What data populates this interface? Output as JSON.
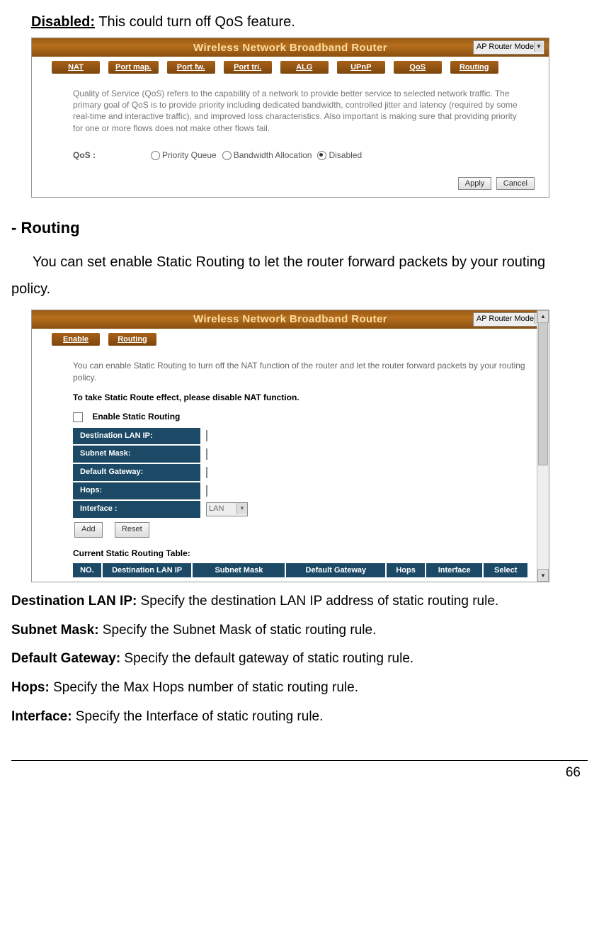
{
  "disabled": {
    "label": "Disabled:",
    "text": "  This could turn off QoS feature."
  },
  "ss1": {
    "banner": "Wireless Network Broadband Router",
    "mode": "AP Router Mode",
    "tabs": [
      "NAT",
      "Port map.",
      "Port fw.",
      "Port tri.",
      "ALG",
      "UPnP",
      "QoS",
      "Routing"
    ],
    "desc": "Quality of Service (QoS) refers to the capability of a network to provide better service to selected network traffic. The primary goal of QoS is to provide priority including dedicated bandwidth, controlled jitter and latency (required by some real-time and interactive traffic), and improved loss characteristics. Also important is making sure that providing priority for one or more flows does not make other flows fail.",
    "qos_label": "QoS :",
    "opts": [
      "Priority Queue",
      "Bandwidth Allocation",
      "Disabled"
    ],
    "apply": "Apply",
    "cancel": "Cancel"
  },
  "routing_heading": "- Routing",
  "routing_para": "You can set enable Static Routing to let the router forward packets by your routing policy.",
  "ss2": {
    "banner": "Wireless Network Broadband Router",
    "mode": "AP Router Mode",
    "tabs": [
      "Enable",
      "Routing"
    ],
    "desc": "You can enable Static Routing to turn off the NAT function of the router and let the router forward packets by your routing policy.",
    "note": "To take Static Route effect, please disable NAT function.",
    "enable_label": "Enable Static Routing",
    "rows": {
      "dlan": "Destination LAN IP:",
      "sm": "Subnet Mask:",
      "dg": "Default Gateway:",
      "hops": "Hops:",
      "iface": "Interface :",
      "iface_val": "LAN"
    },
    "add": "Add",
    "reset": "Reset",
    "cur": "Current Static Routing Table:",
    "th": {
      "no": "NO.",
      "dlan": "Destination LAN IP",
      "sm": "Subnet Mask",
      "dg": "Default Gateway",
      "hops": "Hops",
      "if": "Interface",
      "sel": "Select"
    }
  },
  "defs": {
    "dlan": {
      "t": "Destination LAN IP:",
      "d": " Specify the destination LAN IP address of static routing rule."
    },
    "sm": {
      "t": "Subnet Mask:",
      "d": " Specify the Subnet Mask of static routing rule."
    },
    "dg": {
      "t": "Default Gateway:",
      "d": " Specify the default gateway of static routing rule."
    },
    "hops": {
      "t": "Hops:",
      "d": " Specify the Max Hops number of static routing rule."
    },
    "if": {
      "t": "Interface:",
      "d": " Specify the Interface of static routing rule."
    }
  },
  "page": "66"
}
